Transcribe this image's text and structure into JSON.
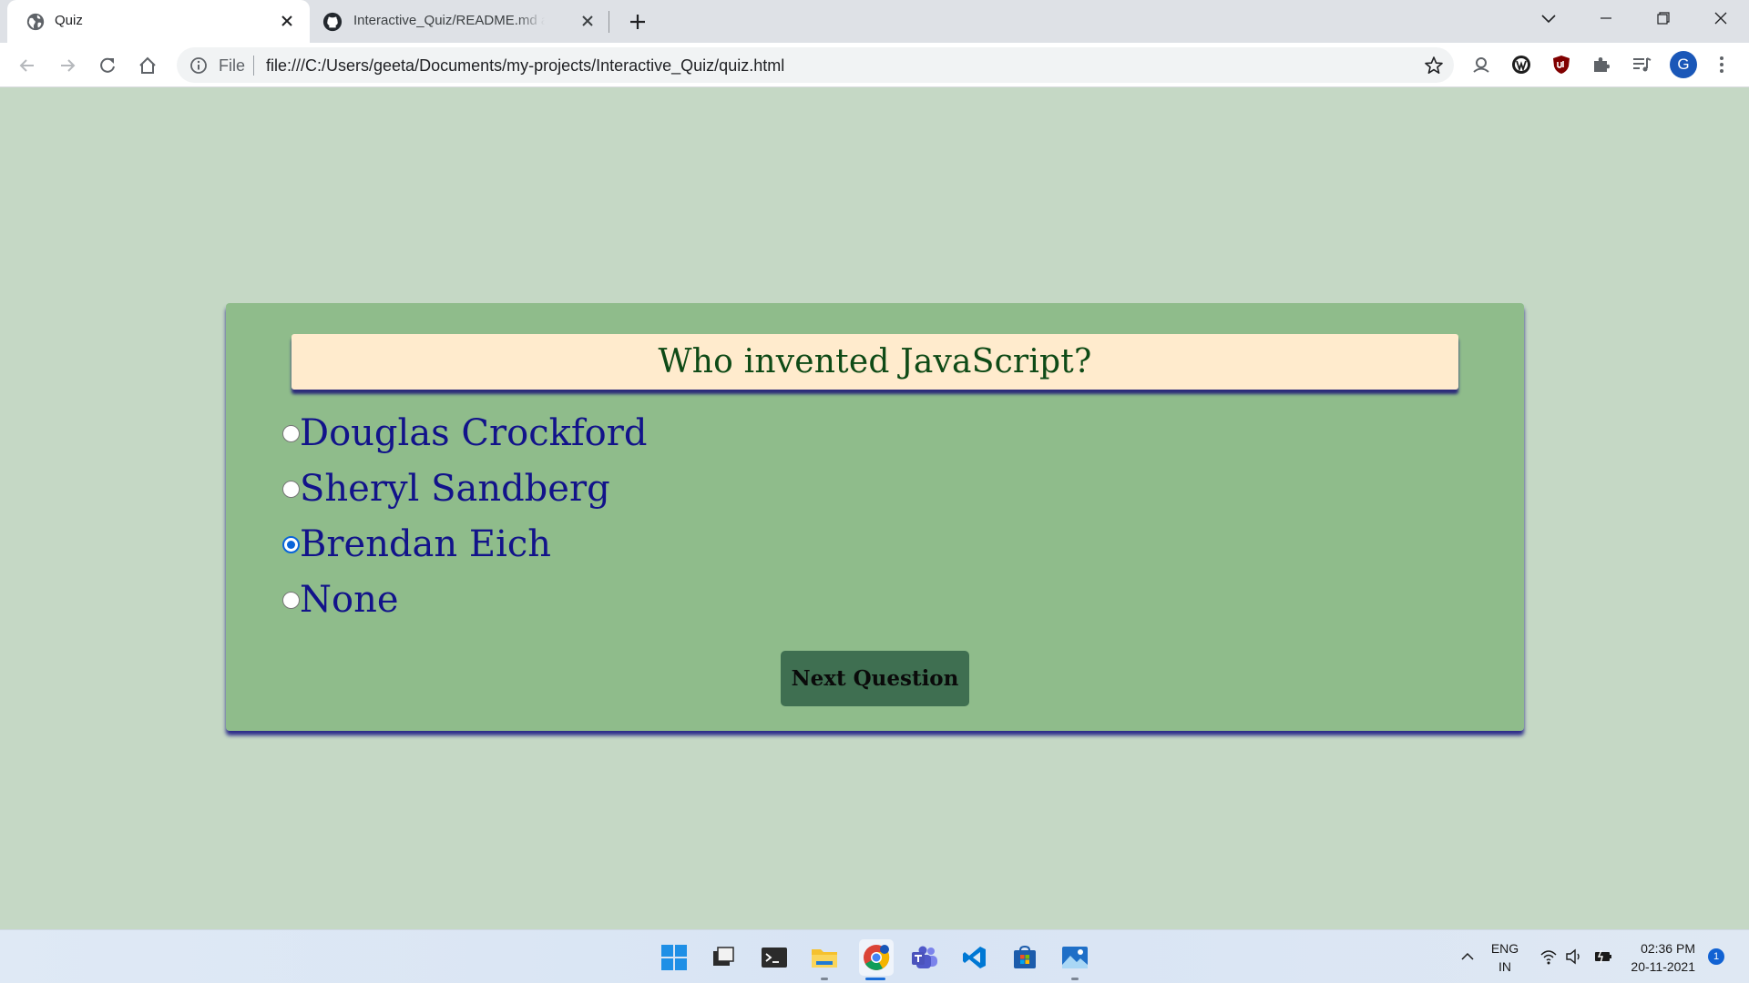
{
  "browser": {
    "tabs": [
      {
        "title": "Quiz",
        "icon": "globe-icon",
        "active": true
      },
      {
        "title": "Interactive_Quiz/README.md at main",
        "icon": "github-icon",
        "active": false
      }
    ],
    "omnibox": {
      "scheme_label": "File",
      "url": "file:///C:/Users/geeta/Documents/my-projects/Interactive_Quiz/quiz.html"
    },
    "profile_initial": "G",
    "extensions": [
      "lens-icon",
      "wordpress-icon",
      "ublock-icon",
      "puzzle-icon",
      "media-icon"
    ]
  },
  "quiz": {
    "question": "Who invented JavaScript?",
    "options": [
      {
        "label": "Douglas Crockford",
        "checked": false
      },
      {
        "label": "Sheryl Sandberg",
        "checked": false
      },
      {
        "label": "Brendan Eich",
        "checked": true
      },
      {
        "label": "None",
        "checked": false
      }
    ],
    "next_button": "Next Question",
    "colors": {
      "page_bg": "#c5d8c5",
      "card_bg": "#8fbc8b",
      "question_bg": "#ffebcd",
      "question_text": "#0e4a16",
      "option_text": "#12138a",
      "button_bg": "#3f6f51"
    }
  },
  "taskbar": {
    "apps": [
      "windows-start-icon",
      "file-explorer-icon",
      "terminal-icon",
      "folder-icon",
      "chrome-icon",
      "teams-icon",
      "vscode-icon",
      "store-icon",
      "photos-icon"
    ],
    "language": {
      "line1": "ENG",
      "line2": "IN"
    },
    "time": "02:36 PM",
    "date": "20-11-2021",
    "notifications": "1"
  }
}
